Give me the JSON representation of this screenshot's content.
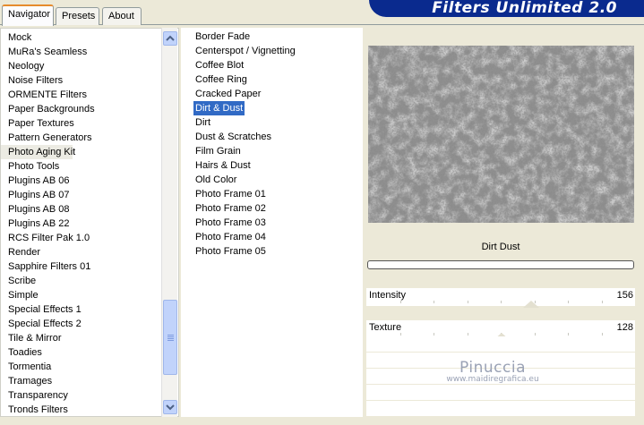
{
  "tabs": [
    {
      "label": "Navigator",
      "active": true
    },
    {
      "label": "Presets",
      "active": false
    },
    {
      "label": "About",
      "active": false
    }
  ],
  "banner_title": "Filters Unlimited 2.0",
  "categories": [
    "Mock",
    "MuRa's Seamless",
    "Neology",
    "Noise Filters",
    "ORMENTE Filters",
    "Paper Backgrounds",
    "Paper Textures",
    "Pattern Generators",
    "Photo Aging Kit",
    "Photo Tools",
    "Plugins AB 06",
    "Plugins AB 07",
    "Plugins AB 08",
    "Plugins AB 22",
    "RCS Filter Pak 1.0",
    "Render",
    "Sapphire Filters 01",
    "Scribe",
    "Simple",
    "Special Effects 1",
    "Special Effects 2",
    "Tile & Mirror",
    "Toadies",
    "Tormentia",
    "Tramages",
    "Transparency",
    "Tronds Filters"
  ],
  "selected_category": "Photo Aging Kit",
  "filters": [
    "Border Fade",
    "Centerspot / Vignetting",
    "Coffee Blot",
    "Coffee Ring",
    "Cracked Paper",
    "Dirt & Dust",
    "Dirt",
    "Dust & Scratches",
    "Film Grain",
    "Hairs & Dust",
    "Old Color",
    "Photo Frame 01",
    "Photo Frame 02",
    "Photo Frame 03",
    "Photo Frame 04",
    "Photo Frame 05"
  ],
  "selected_filter": "Dirt & Dust",
  "preview_label": "Dirt  Dust",
  "params": [
    {
      "name": "Intensity",
      "value": "156",
      "level": 156
    },
    {
      "name": "Texture",
      "value": "128",
      "level": 128
    }
  ],
  "watermark": {
    "line1": "Pinuccia",
    "line2": "www.maidiregrafica.eu"
  },
  "colors": {
    "selection": "#316ac5",
    "banner": "#0a2a8e",
    "tab_accent": "#e68b2c"
  }
}
